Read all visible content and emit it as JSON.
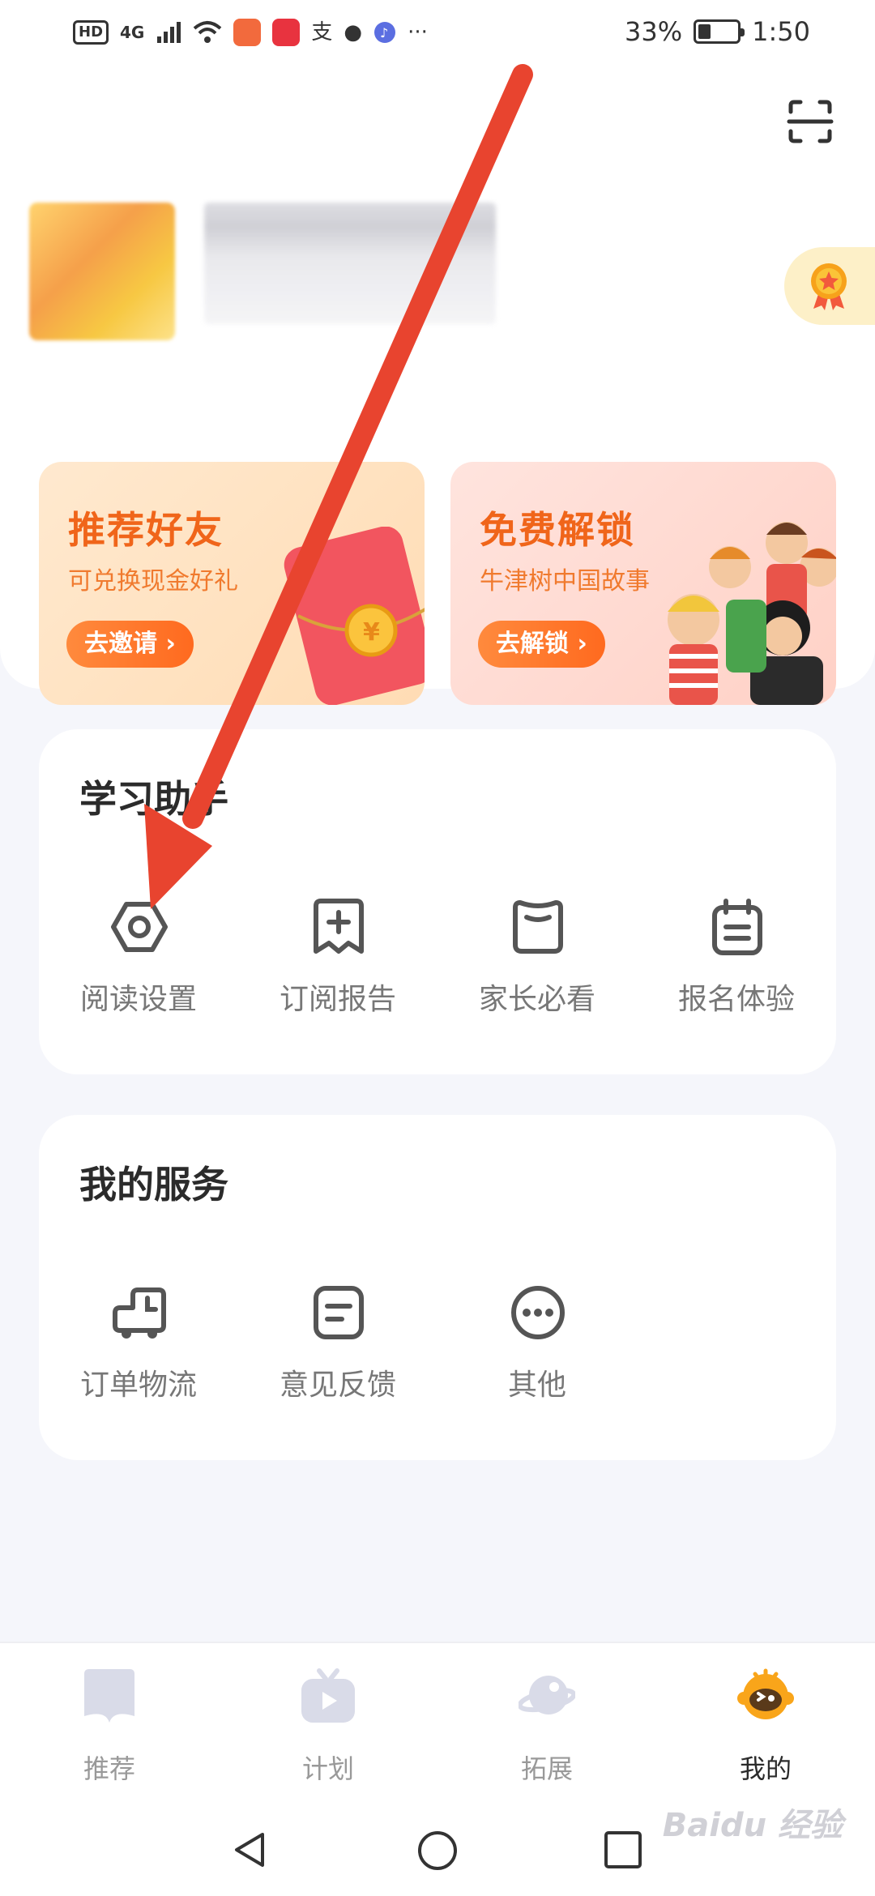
{
  "status_bar": {
    "left_icons": [
      "HD",
      "4G",
      "signal-icon",
      "wifi-icon",
      "app-icon-1",
      "app-icon-2",
      "支",
      "cat-icon",
      "music-icon",
      "···"
    ],
    "battery": "33%",
    "battery_level": 0.33,
    "time": "1:50"
  },
  "profile": {
    "scan_icon": "scan-icon",
    "medal_icon": "medal-icon"
  },
  "promos": [
    {
      "title": "推荐好友",
      "subtitle": "可兑换现金好礼",
      "button": "去邀请 ›"
    },
    {
      "title": "免费解锁",
      "subtitle": "牛津树中国故事",
      "button": "去解锁 ›"
    }
  ],
  "study_helper": {
    "title": "学习助手",
    "items": [
      {
        "label": "阅读设置",
        "icon": "settings-hex-icon"
      },
      {
        "label": "订阅报告",
        "icon": "report-add-icon"
      },
      {
        "label": "家长必看",
        "icon": "book-icon"
      },
      {
        "label": "报名体验",
        "icon": "calendar-icon"
      }
    ]
  },
  "my_services": {
    "title": "我的服务",
    "items": [
      {
        "label": "订单物流",
        "icon": "truck-icon"
      },
      {
        "label": "意见反馈",
        "icon": "feedback-icon"
      },
      {
        "label": "其他",
        "icon": "more-icon"
      }
    ]
  },
  "bottom_nav": [
    {
      "label": "推荐",
      "icon": "book-nav-icon"
    },
    {
      "label": "计划",
      "icon": "tv-play-icon"
    },
    {
      "label": "拓展",
      "icon": "planet-icon"
    },
    {
      "label": "我的",
      "icon": "mascot-icon"
    }
  ],
  "watermark": "Baidu 经验",
  "colors": {
    "accent_orange": "#f0651a",
    "arrow_red": "#e8442f",
    "icon_gray": "#555555",
    "mascot_yellow": "#f9a51a"
  }
}
